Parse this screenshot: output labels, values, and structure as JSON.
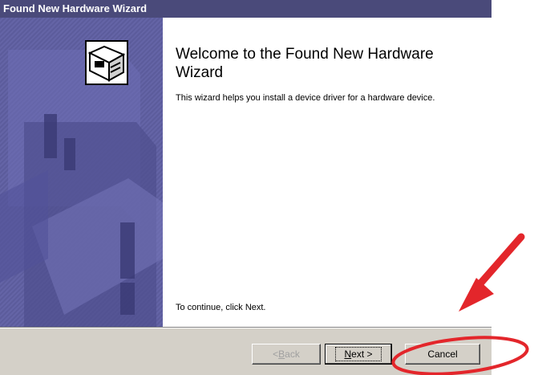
{
  "window": {
    "title": "Found New Hardware Wizard"
  },
  "wizard": {
    "heading": "Welcome to the Found New Hardware Wizard",
    "intro": "This wizard helps you install a device driver for a hardware device.",
    "continue_text": "To continue, click Next."
  },
  "buttons": {
    "back": {
      "prefix": "< ",
      "mnemonic": "B",
      "rest": "ack"
    },
    "next": {
      "mnemonic": "N",
      "rest": "ext >"
    },
    "cancel": "Cancel"
  },
  "icons": {
    "hardware": "hardware-box-icon",
    "arrow": "red-arrow-icon"
  },
  "colors": {
    "titlebar": "#4a4a7a",
    "panel": "#5c5c9c",
    "annotation": "#e3262b",
    "dialog": "#d4d0c8"
  }
}
